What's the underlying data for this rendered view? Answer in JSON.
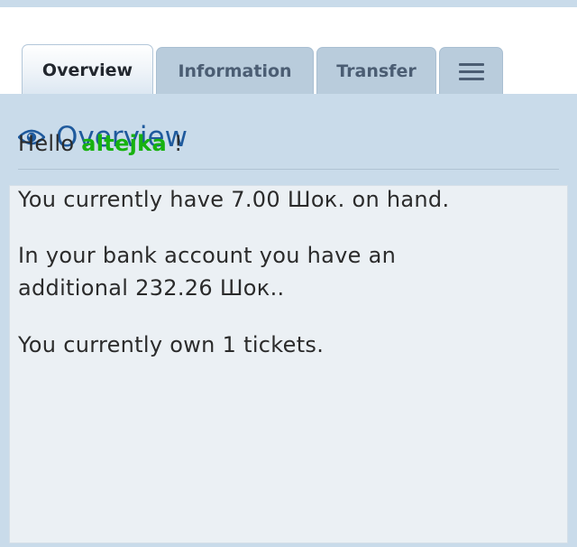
{
  "tabs": [
    {
      "label": "Overview",
      "active": true
    },
    {
      "label": "Information",
      "active": false
    },
    {
      "label": "Transfer",
      "active": false
    }
  ],
  "menu_icon": "hamburger-menu-icon",
  "panel": {
    "icon": "eye-icon",
    "title": "Overview"
  },
  "greeting": {
    "prefix": "Hello",
    "username": "altejka",
    "suffix": "!"
  },
  "messages": {
    "on_hand": "You currently have 7.00 Шок. on hand.",
    "bank_line1": "In your bank account you have an",
    "bank_line2": "additional 232.26 Шок..",
    "tickets": "You currently own 1 tickets."
  },
  "colors": {
    "title_blue": "#1f5a9d",
    "username_green": "#17b20f",
    "panel_bg": "#c9dbea",
    "content_bg": "#ebf0f4"
  }
}
